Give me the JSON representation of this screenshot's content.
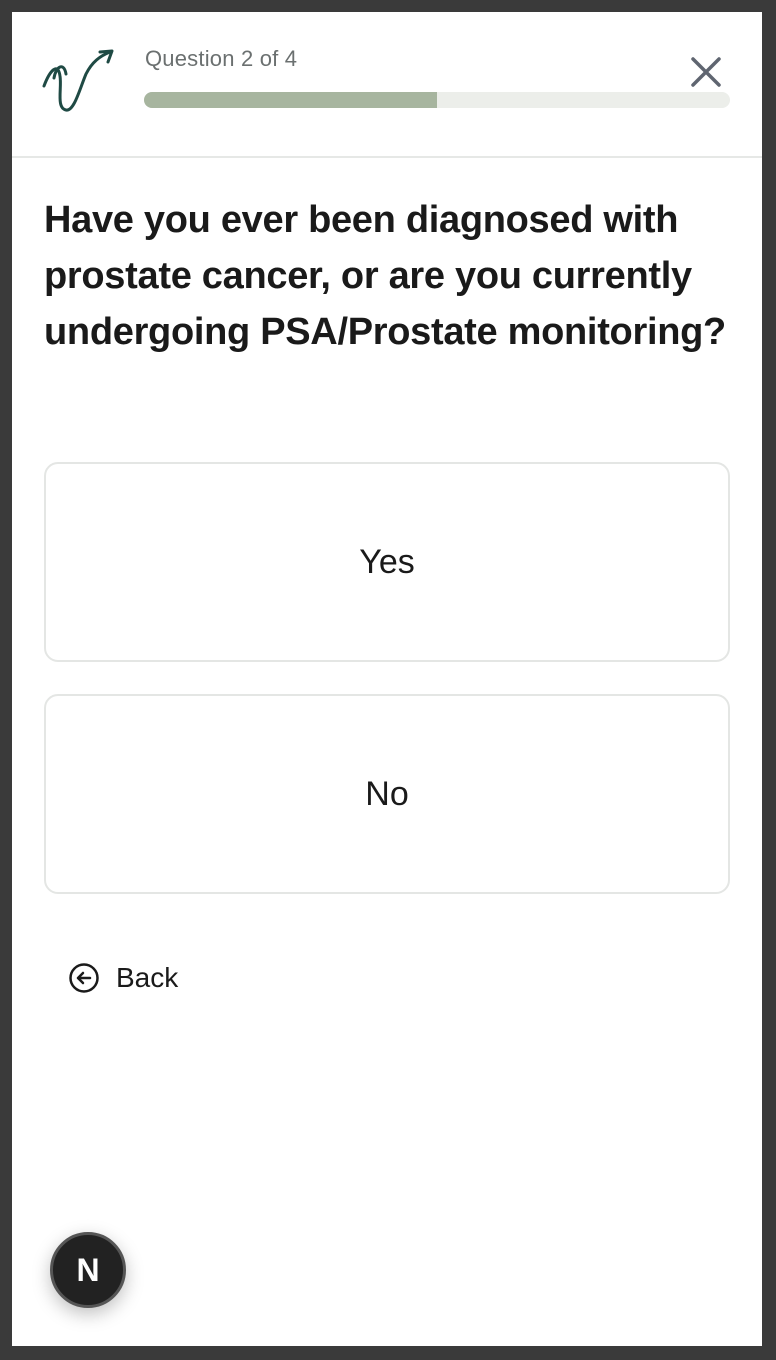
{
  "header": {
    "question_counter": "Question 2 of 4",
    "progress_fraction": 0.5,
    "close_icon": "close-icon",
    "logo_icon": "signature-arrow-logo"
  },
  "question": {
    "text": "Have you ever been diagnosed with prostate cancer, or are you currently undergoing PSA/Prostate monitoring?"
  },
  "options": [
    {
      "label": "Yes"
    },
    {
      "label": "No"
    }
  ],
  "back": {
    "label": "Back",
    "icon": "arrow-left-circle-icon"
  },
  "avatar": {
    "letter": "N"
  },
  "colors": {
    "progress_fill": "#a7b59f",
    "progress_track": "#eceeea",
    "logo": "#1f4a44",
    "text": "#1a1a1a"
  }
}
